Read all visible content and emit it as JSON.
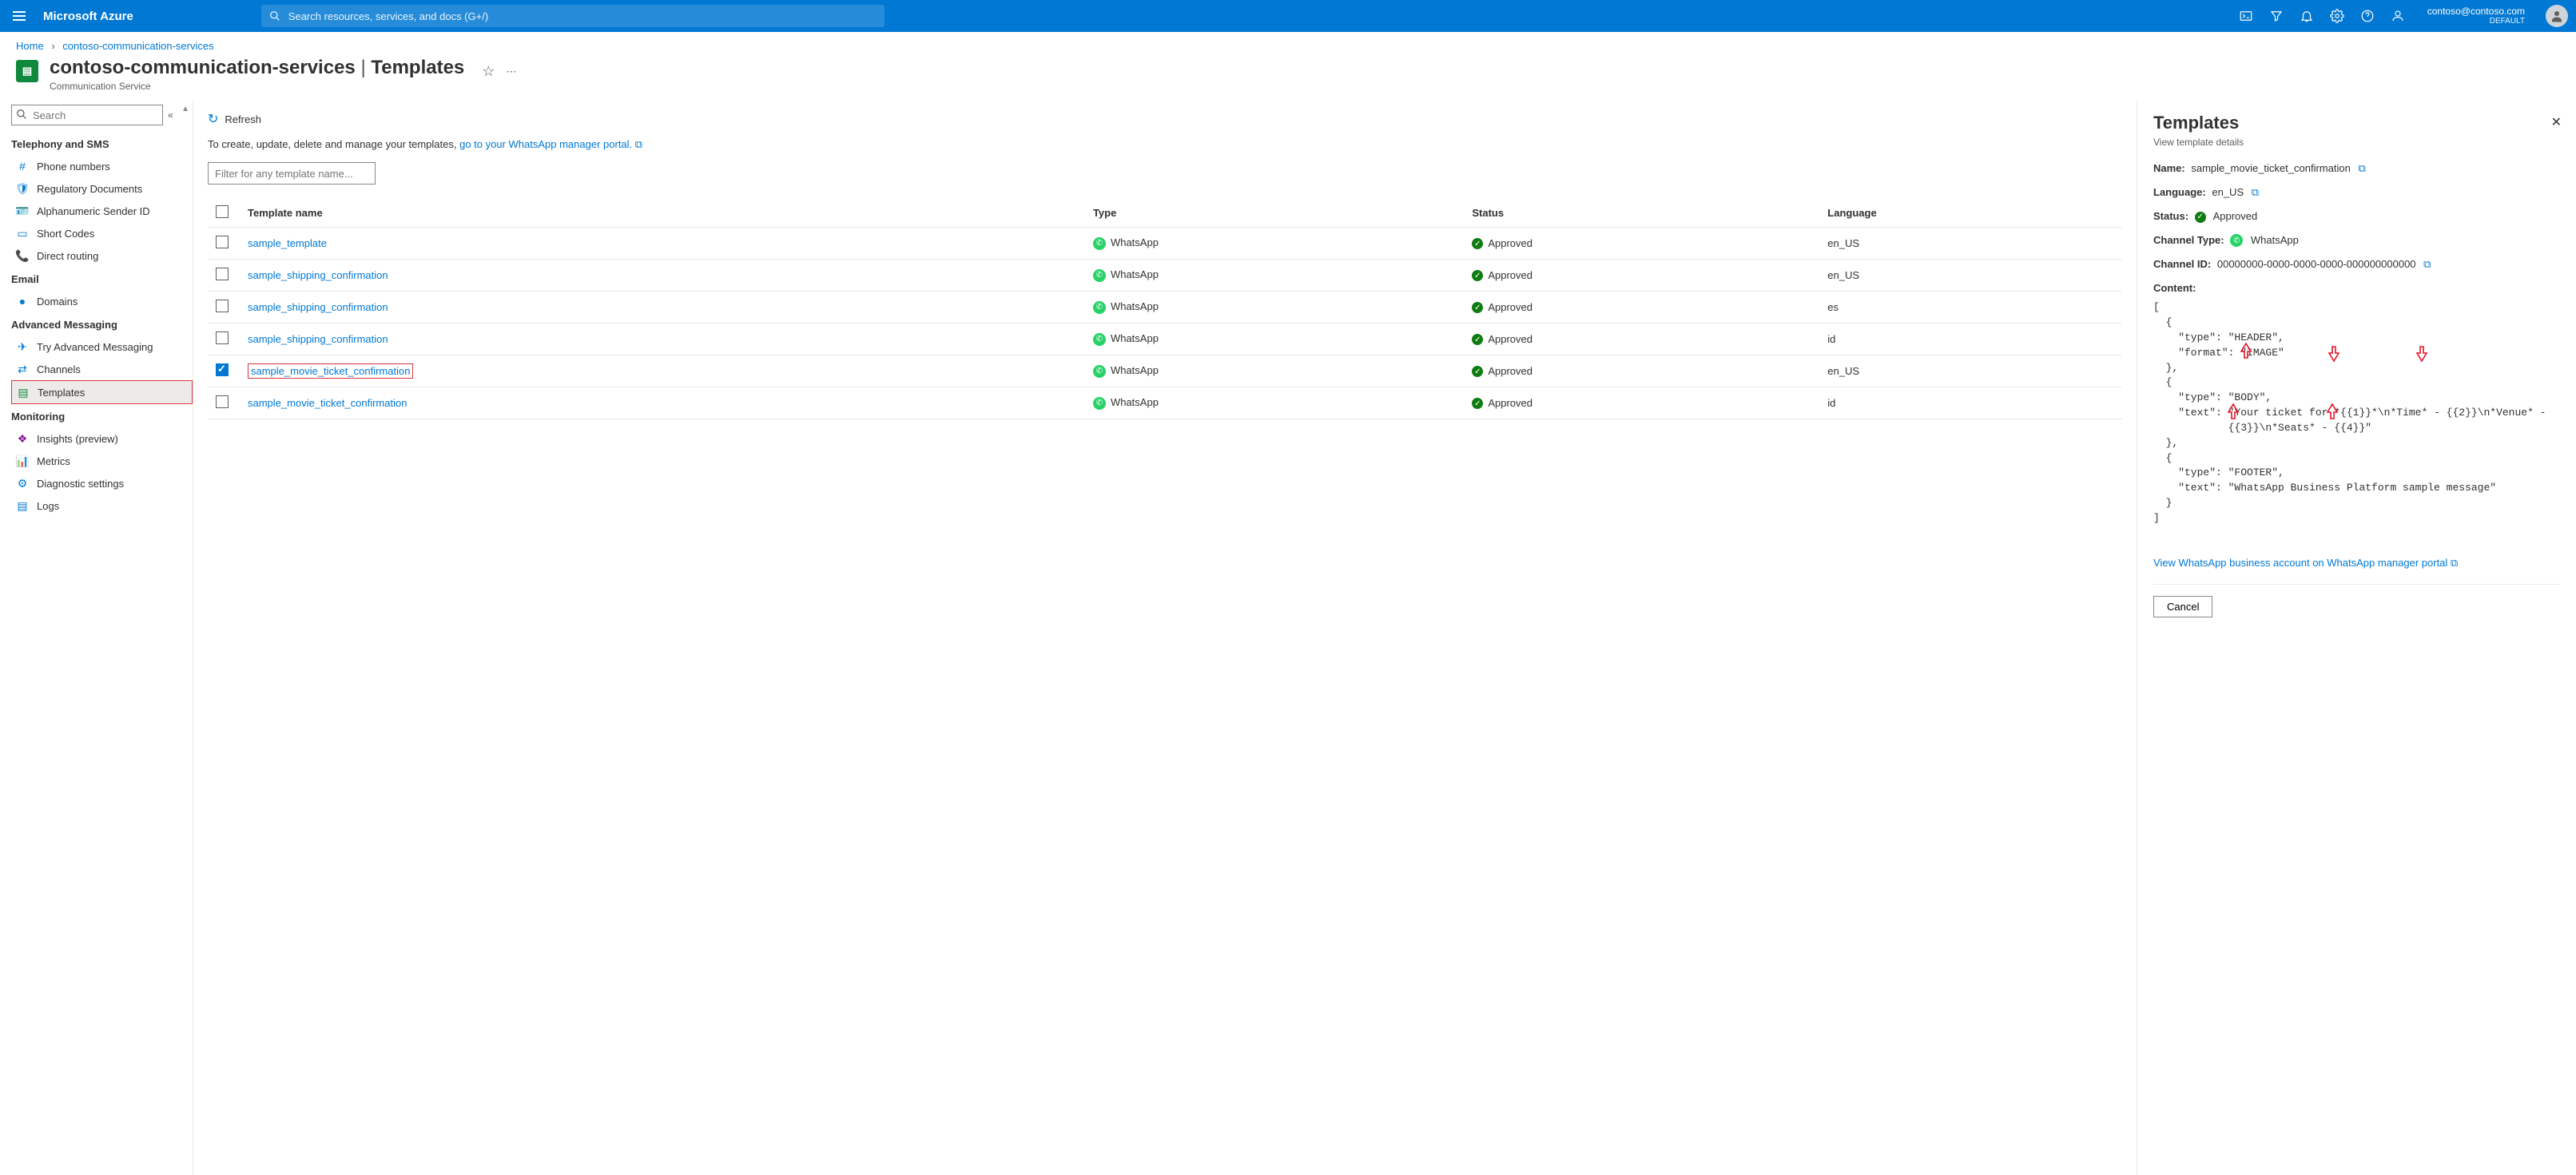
{
  "topbar": {
    "brand": "Microsoft Azure",
    "search_placeholder": "Search resources, services, and docs (G+/)",
    "account_email": "contoso@contoso.com",
    "account_tenant": "DEFAULT"
  },
  "breadcrumb": {
    "home": "Home",
    "resource": "contoso-communication-services"
  },
  "title": {
    "resource": "contoso-communication-services",
    "section": "Templates",
    "subtitle": "Communication Service"
  },
  "sidebar": {
    "search_placeholder": "Search",
    "groups": [
      {
        "label": "Telephony and SMS",
        "items": [
          {
            "icon": "#",
            "icolor": "#0078d4",
            "label": "Phone numbers"
          },
          {
            "icon": "🛡",
            "icolor": "#0078d4",
            "label": "Regulatory Documents"
          },
          {
            "icon": "🪪",
            "icolor": "#0078d4",
            "label": "Alphanumeric Sender ID"
          },
          {
            "icon": "▭",
            "icolor": "#0078d4",
            "label": "Short Codes"
          },
          {
            "icon": "📞",
            "icolor": "#d83b01",
            "label": "Direct routing"
          }
        ]
      },
      {
        "label": "Email",
        "items": [
          {
            "icon": "●",
            "icolor": "#0078d4",
            "label": "Domains"
          }
        ]
      },
      {
        "label": "Advanced Messaging",
        "items": [
          {
            "icon": "✈",
            "icolor": "#0078d4",
            "label": "Try Advanced Messaging"
          },
          {
            "icon": "⇄",
            "icolor": "#0078d4",
            "label": "Channels"
          },
          {
            "icon": "▤",
            "icolor": "#10893e",
            "label": "Templates",
            "active": true
          }
        ]
      },
      {
        "label": "Monitoring",
        "items": [
          {
            "icon": "❖",
            "icolor": "#881798",
            "label": "Insights (preview)"
          },
          {
            "icon": "📊",
            "icolor": "#0078d4",
            "label": "Metrics"
          },
          {
            "icon": "⚙",
            "icolor": "#0078d4",
            "label": "Diagnostic settings"
          },
          {
            "icon": "▤",
            "icolor": "#0078d4",
            "label": "Logs"
          }
        ]
      }
    ]
  },
  "main": {
    "refresh": "Refresh",
    "help_prefix": "To create, update, delete and manage your templates, ",
    "help_link": "go to your WhatsApp manager portal.",
    "filter_placeholder": "Filter for any template name...",
    "columns": [
      "Template name",
      "Type",
      "Status",
      "Language"
    ],
    "type_label": "WhatsApp",
    "status_label": "Approved",
    "rows": [
      {
        "name": "sample_template",
        "lang": "en_US",
        "checked": false
      },
      {
        "name": "sample_shipping_confirmation",
        "lang": "en_US",
        "checked": false
      },
      {
        "name": "sample_shipping_confirmation",
        "lang": "es",
        "checked": false
      },
      {
        "name": "sample_shipping_confirmation",
        "lang": "id",
        "checked": false
      },
      {
        "name": "sample_movie_ticket_confirmation",
        "lang": "en_US",
        "checked": true,
        "highlight": true
      },
      {
        "name": "sample_movie_ticket_confirmation",
        "lang": "id",
        "checked": false
      }
    ]
  },
  "panel": {
    "title": "Templates",
    "subtitle": "View template details",
    "name_label": "Name:",
    "name_value": "sample_movie_ticket_confirmation",
    "language_label": "Language:",
    "language_value": "en_US",
    "status_label": "Status:",
    "status_value": "Approved",
    "channel_type_label": "Channel Type:",
    "channel_type_value": "WhatsApp",
    "channel_id_label": "Channel ID:",
    "channel_id_value": "00000000-0000-0000-0000-000000000000",
    "content_label": "Content:",
    "content_text": "[\n  {\n    \"type\": \"HEADER\",\n    \"format\": \"IMAGE\"\n  },\n  {\n    \"type\": \"BODY\",\n    \"text\": \"Your ticket for *{{1}}*\\n*Time* - {{2}}\\n*Venue* -\n            {{3}}\\n*Seats* - {{4}}\"\n  },\n  {\n    \"type\": \"FOOTER\",\n    \"text\": \"WhatsApp Business Platform sample message\"\n  }\n]",
    "portal_link": "View WhatsApp business account on WhatsApp manager portal",
    "cancel": "Cancel"
  }
}
